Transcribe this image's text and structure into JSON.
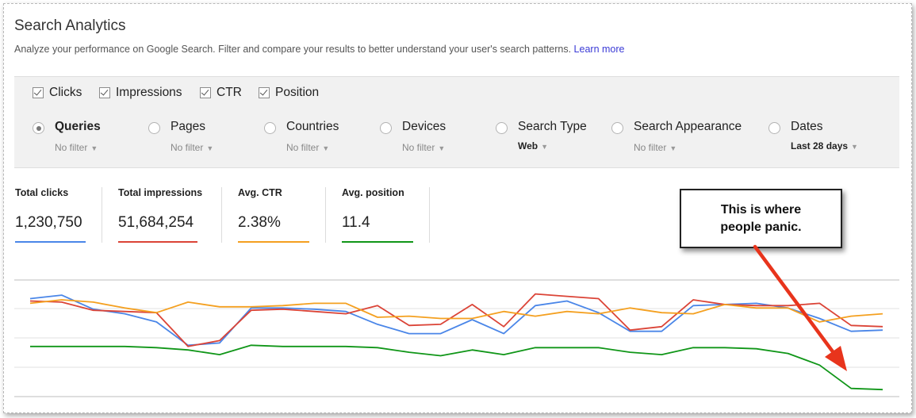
{
  "header": {
    "title": "Search Analytics",
    "subtitle": "Analyze your performance on Google Search. Filter and compare your results to better understand your user's search patterns.",
    "learn_more": "Learn more"
  },
  "metrics": [
    {
      "label": "Clicks",
      "checked": true
    },
    {
      "label": "Impressions",
      "checked": true
    },
    {
      "label": "CTR",
      "checked": true
    },
    {
      "label": "Position",
      "checked": true
    }
  ],
  "filters": [
    {
      "label": "Queries",
      "value": "No filter",
      "selected": true
    },
    {
      "label": "Pages",
      "value": "No filter",
      "selected": false
    },
    {
      "label": "Countries",
      "value": "No filter",
      "selected": false
    },
    {
      "label": "Devices",
      "value": "No filter",
      "selected": false
    },
    {
      "label": "Search Type",
      "value": "Web",
      "selected": false
    },
    {
      "label": "Search Appearance",
      "value": "No filter",
      "selected": false
    },
    {
      "label": "Dates",
      "value": "Last 28 days",
      "selected": false
    }
  ],
  "stats": [
    {
      "label": "Total clicks",
      "value": "1,230,750",
      "color": "#4a86e8"
    },
    {
      "label": "Total impressions",
      "value": "51,684,254",
      "color": "#db4437"
    },
    {
      "label": "Avg. CTR",
      "value": "2.38%",
      "color": "#f4a020"
    },
    {
      "label": "Avg. position",
      "value": "11.4",
      "color": "#109618"
    }
  ],
  "callout": {
    "line1": "This is where",
    "line2": "people panic."
  },
  "chart_data": {
    "type": "line",
    "x": [
      1,
      2,
      3,
      4,
      5,
      6,
      7,
      8,
      9,
      10,
      11,
      12,
      13,
      14,
      15,
      16,
      17,
      18,
      19,
      20,
      21,
      22,
      23,
      24,
      25,
      26,
      27,
      28
    ],
    "ylim": [
      0,
      100
    ],
    "grid": true,
    "series": [
      {
        "name": "Total clicks",
        "color": "#4a86e8",
        "values": [
          84,
          87,
          75,
          71,
          64,
          44,
          46,
          76,
          76,
          75,
          73,
          62,
          54,
          54,
          66,
          54,
          78,
          82,
          72,
          56,
          56,
          78,
          79,
          80,
          76,
          67,
          56,
          57
        ]
      },
      {
        "name": "Total impressions",
        "color": "#db4437",
        "values": [
          82,
          81,
          74,
          73,
          72,
          43,
          48,
          74,
          75,
          73,
          71,
          78,
          61,
          62,
          79,
          60,
          88,
          86,
          84,
          57,
          60,
          83,
          79,
          78,
          78,
          80,
          61,
          60
        ]
      },
      {
        "name": "Avg. CTR",
        "color": "#f4a020",
        "values": [
          80,
          83,
          81,
          76,
          72,
          81,
          77,
          77,
          78,
          80,
          80,
          68,
          69,
          67,
          67,
          73,
          69,
          73,
          71,
          76,
          72,
          71,
          79,
          76,
          76,
          64,
          69,
          71
        ]
      },
      {
        "name": "Avg. position",
        "color": "#109618",
        "values": [
          43,
          43,
          43,
          43,
          42,
          40,
          36,
          44,
          43,
          43,
          43,
          42,
          38,
          35,
          40,
          36,
          42,
          42,
          42,
          38,
          36,
          42,
          42,
          41,
          37,
          27,
          7,
          6
        ]
      }
    ]
  }
}
